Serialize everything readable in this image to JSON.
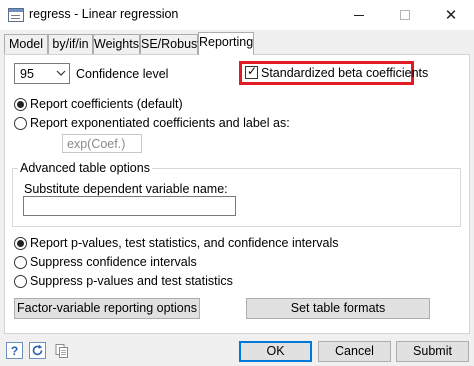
{
  "window": {
    "title": "regress - Linear regression"
  },
  "tabs": [
    {
      "label": "Model"
    },
    {
      "label": "by/if/in"
    },
    {
      "label": "Weights"
    },
    {
      "label": "SE/Robust"
    },
    {
      "label": "Reporting"
    }
  ],
  "active_tab": "Reporting",
  "confidence": {
    "value": "95",
    "label": "Confidence level"
  },
  "standardized": {
    "label": "Standardized beta coefficients",
    "checked": true
  },
  "coef_options": {
    "report_coefficients": "Report coefficients (default)",
    "report_exponentiated": "Report exponentiated coefficients and label as:",
    "exp_placeholder": "exp(Coef.)"
  },
  "advanced": {
    "title": "Advanced table options",
    "substitute_label": "Substitute dependent variable name:",
    "substitute_value": ""
  },
  "pvalue_options": {
    "report_pvalues": "Report p-values, test statistics, and confidence intervals",
    "suppress_ci": "Suppress confidence intervals",
    "suppress_pvalues": "Suppress p-values and test statistics"
  },
  "buttons": {
    "factor_variable": "Factor-variable reporting options",
    "set_table_formats": "Set table formats",
    "ok": "OK",
    "cancel": "Cancel",
    "submit": "Submit"
  },
  "toolbar_icons": [
    "help-icon",
    "reset-icon",
    "copy-icon"
  ],
  "colors": {
    "highlight": "#e21b23",
    "default_button_border": "#0078d7"
  }
}
